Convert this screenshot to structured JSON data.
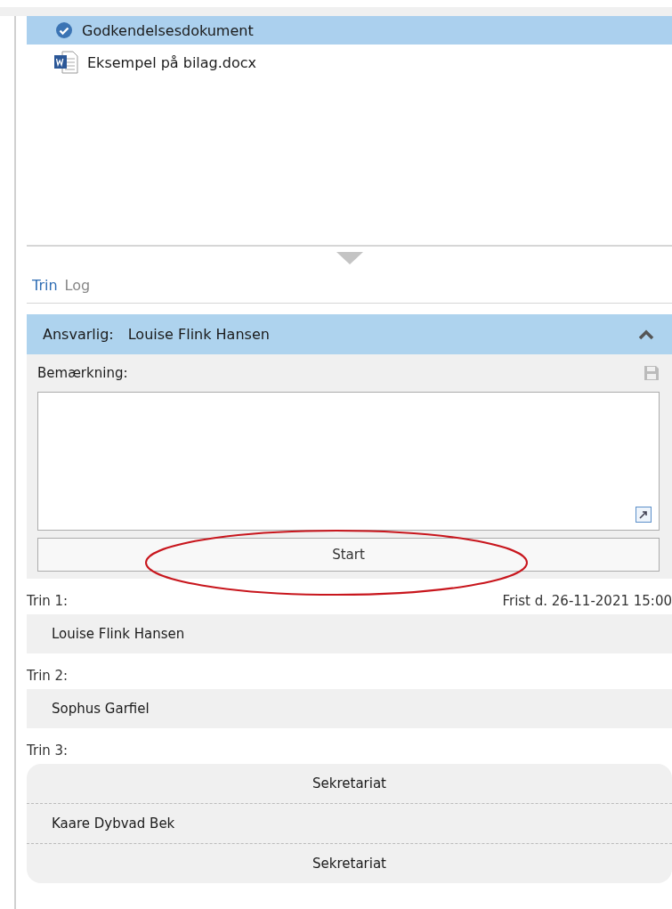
{
  "documents": [
    {
      "name": "Godkendelsesdokument",
      "kind": "approved",
      "selected": true
    },
    {
      "name": "Eksempel på bilag.docx",
      "kind": "word",
      "selected": false
    }
  ],
  "tabs": [
    {
      "label": "Trin",
      "selected": true
    },
    {
      "label": "Log",
      "selected": false
    }
  ],
  "responsible": {
    "label": "Ansvarlig:",
    "name": "Louise Flink Hansen",
    "expanded": true
  },
  "remark": {
    "label": "Bemærkning:"
  },
  "start_button": {
    "label": "Start",
    "circled": true
  },
  "steps": [
    {
      "label": "Trin 1:",
      "deadline": "Frist d. 26-11-2021 15:00",
      "members": [
        {
          "kind": "person",
          "name": "Louise Flink Hansen"
        }
      ]
    },
    {
      "label": "Trin 2:",
      "members": [
        {
          "kind": "person",
          "name": "Sophus Garfiel"
        }
      ]
    },
    {
      "label": "Trin 3:",
      "members": [
        {
          "kind": "group",
          "name": "Sekretariat"
        },
        {
          "kind": "person",
          "name": "Kaare Dybvad Bek"
        },
        {
          "kind": "group",
          "name": "Sekretariat"
        }
      ]
    }
  ]
}
